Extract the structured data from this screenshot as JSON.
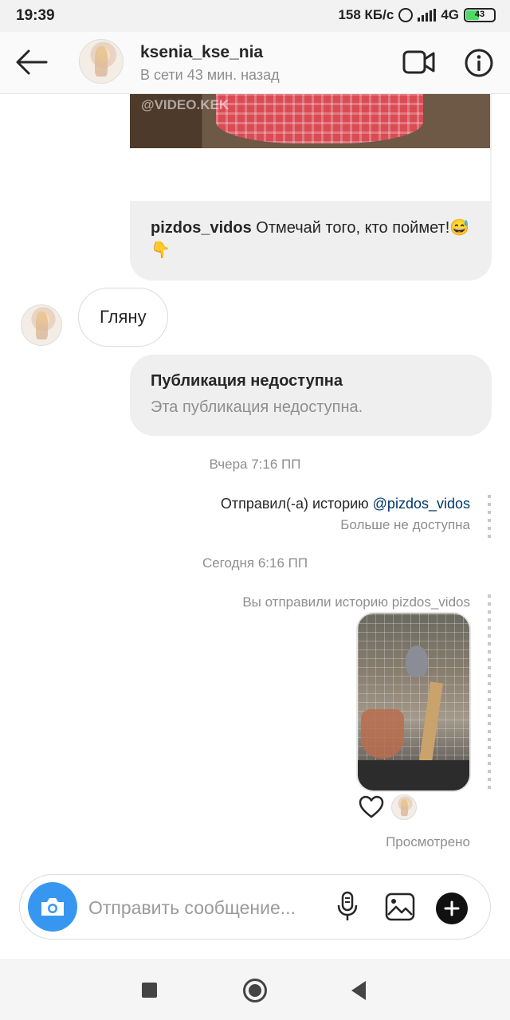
{
  "status_bar": {
    "time": "19:39",
    "speed": "158 КБ/с",
    "network": "4G",
    "battery": "43"
  },
  "header": {
    "username": "ksenia_kse_nia",
    "presence": "В сети 43 мин. назад",
    "back_icon": "arrow-left-icon",
    "video_icon": "video-call-icon",
    "info_icon": "info-icon"
  },
  "messages": {
    "shared_post": {
      "watermark": "@VIDEO.KEK",
      "author": "pizdos_vidos",
      "caption": "Отмечай того, кто поймет!😅👇"
    },
    "reply": "Гляну",
    "unavailable": {
      "title": "Публикация недоступна",
      "subtitle": "Эта публикация недоступна."
    },
    "timestamp_1": "Вчера 7:16 ПП",
    "story_sent": {
      "prefix": "Отправил(-а) историю",
      "mention": "@pizdos_vidos",
      "note": "Больше не доступна"
    },
    "timestamp_2": "Сегодня 6:16 ПП",
    "you_sent_story": "Вы отправили историю pizdos_vidos",
    "seen": "Просмотрено"
  },
  "composer": {
    "placeholder": "Отправить сообщение...",
    "camera_icon": "camera-icon",
    "mic_icon": "microphone-icon",
    "gallery_icon": "gallery-icon",
    "plus_icon": "plus-icon"
  },
  "colors": {
    "accent": "#3797f0",
    "bubble": "#efefef",
    "mention": "#00376b",
    "muted": "#8e8e8e"
  }
}
